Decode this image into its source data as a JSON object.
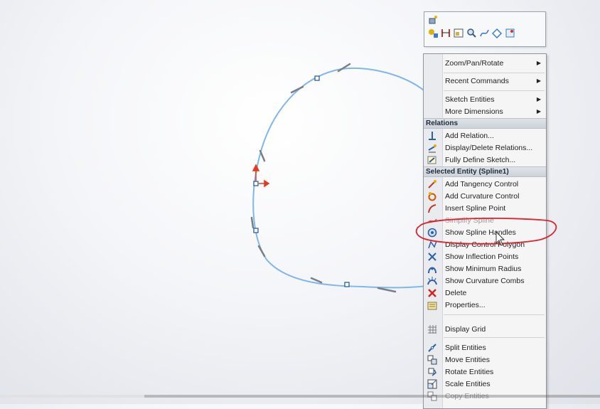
{
  "toolbar": {
    "row1": [
      "view-orientation-icon"
    ],
    "row2": [
      "add-relation-toolbar-icon",
      "smart-dimension-icon",
      "sketch-picture-icon",
      "zoom-icon",
      "spline-tools-icon",
      "trim-icon",
      "options-icon"
    ]
  },
  "menu": {
    "items": {
      "zoom_pan_rotate": "Zoom/Pan/Rotate",
      "recent_commands": "Recent Commands",
      "sketch_entities": "Sketch Entities",
      "more_dimensions": "More Dimensions",
      "add_relation": "Add Relation...",
      "display_delete_relations": "Display/Delete Relations...",
      "fully_define_sketch": "Fully Define Sketch...",
      "add_tangency_control": "Add Tangency Control",
      "add_curvature_control": "Add Curvature Control",
      "insert_spline_point": "Insert Spline Point",
      "simplify_spline": "Simplify Spline",
      "show_spline_handles": "Show Spline Handles",
      "display_control_polygon": "Display Control Polygon",
      "show_inflection_points": "Show Inflection Points",
      "show_minimum_radius": "Show Minimum Radius",
      "show_curvature_combs": "Show Curvature Combs",
      "delete": "Delete",
      "properties": "Properties...",
      "display_grid": "Display Grid",
      "split_entities": "Split Entities",
      "move_entities": "Move Entities",
      "rotate_entities": "Rotate Entities",
      "scale_entities": "Scale Entities",
      "copy_entities": "Copy Entities"
    },
    "headers": {
      "relations": "Relations",
      "selected_entity": "Selected Entity (Spline1)"
    }
  },
  "video_progress": 0.24,
  "colors": {
    "spline": "#7fb6ec",
    "highlight_circle": "#e0202a",
    "arrow_red": "#e53a1e",
    "menu_header": "#1e2a38"
  }
}
